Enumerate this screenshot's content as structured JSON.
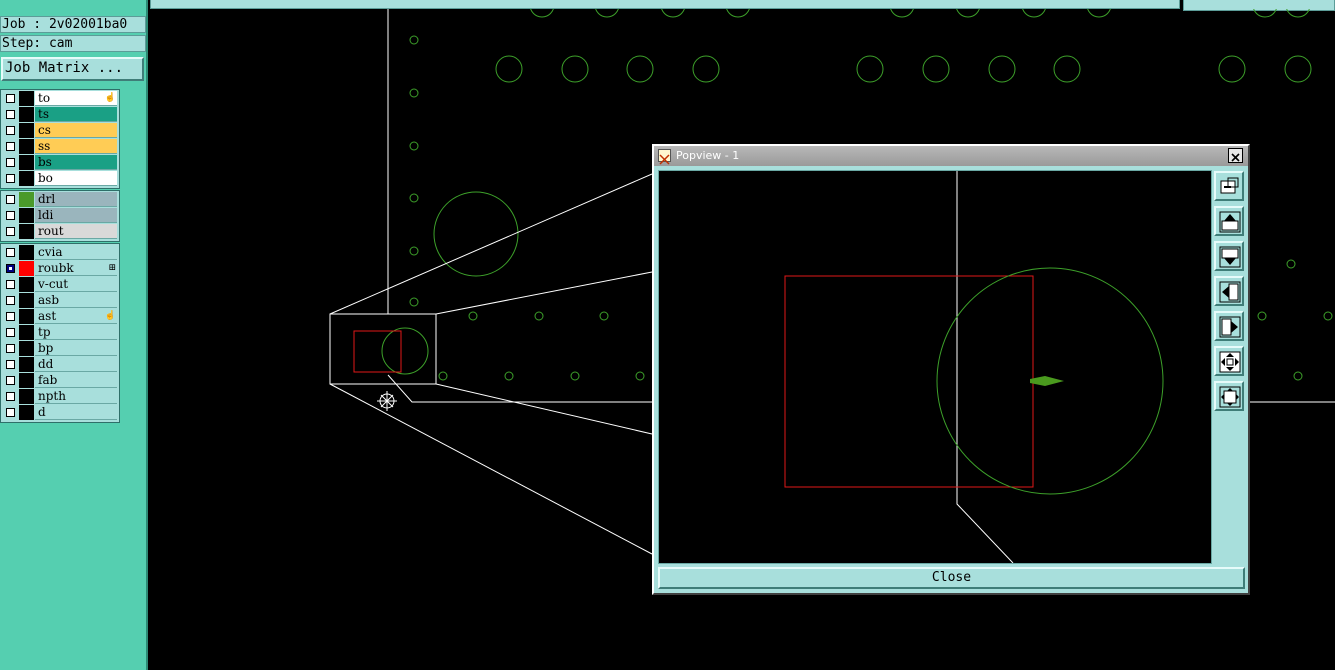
{
  "job_panel": {
    "job_text": "Job : 2v02001ba0",
    "step_text": "Step: cam",
    "job_matrix_label": "Job Matrix ..."
  },
  "layers": {
    "group1": [
      {
        "name": "to",
        "bg": "#ffffff",
        "swatch": "#000000",
        "mark": "hand-icon"
      },
      {
        "name": "ts",
        "bg": "#1aa085",
        "swatch": "#000000",
        "mark": ""
      },
      {
        "name": "cs",
        "bg": "#ffcc55",
        "swatch": "#000000",
        "mark": ""
      },
      {
        "name": "ss",
        "bg": "#ffcc55",
        "swatch": "#000000",
        "mark": ""
      },
      {
        "name": "bs",
        "bg": "#1aa085",
        "swatch": "#000000",
        "mark": ""
      },
      {
        "name": "bo",
        "bg": "#ffffff",
        "swatch": "#000000",
        "mark": ""
      }
    ],
    "group2": [
      {
        "name": "drl",
        "bg": "#9ab5bd",
        "swatch": "#4a9a2a",
        "mark": ""
      },
      {
        "name": "ldi",
        "bg": "#9ab5bd",
        "swatch": "#000000",
        "mark": ""
      },
      {
        "name": "rout",
        "bg": "#d9d9d9",
        "swatch": "#000000",
        "mark": ""
      }
    ],
    "group3": [
      {
        "name": "cvia",
        "bg": "#a8dfdc",
        "swatch": "#000000",
        "mark": ""
      },
      {
        "name": "roubk",
        "bg": "#a8dfdc",
        "swatch": "#ff0000",
        "mark": "plus-box-icon",
        "selected": true
      },
      {
        "name": "v-cut",
        "bg": "#a8dfdc",
        "swatch": "#000000",
        "mark": ""
      },
      {
        "name": "asb",
        "bg": "#a8dfdc",
        "swatch": "#000000",
        "mark": ""
      },
      {
        "name": "ast",
        "bg": "#a8dfdc",
        "swatch": "#000000",
        "mark": "hand-icon"
      },
      {
        "name": "tp",
        "bg": "#a8dfdc",
        "swatch": "#000000",
        "mark": ""
      },
      {
        "name": "bp",
        "bg": "#a8dfdc",
        "swatch": "#000000",
        "mark": ""
      },
      {
        "name": "dd",
        "bg": "#a8dfdc",
        "swatch": "#000000",
        "mark": ""
      },
      {
        "name": "fab",
        "bg": "#a8dfdc",
        "swatch": "#000000",
        "mark": ""
      },
      {
        "name": "npth",
        "bg": "#a8dfdc",
        "swatch": "#000000",
        "mark": ""
      },
      {
        "name": "d",
        "bg": "#a8dfdc",
        "swatch": "#000000",
        "mark": ""
      }
    ]
  },
  "popview": {
    "title": "Popview - 1",
    "close_label": "Close",
    "toolbar": [
      {
        "icon": "zoom-window-icon"
      },
      {
        "icon": "pan-up-icon"
      },
      {
        "icon": "pan-down-icon"
      },
      {
        "icon": "pan-left-icon"
      },
      {
        "icon": "pan-right-icon"
      },
      {
        "icon": "zoom-fit-icon"
      },
      {
        "icon": "zoom-center-icon"
      }
    ]
  },
  "colors": {
    "panel_bg": "#55cfb0",
    "widget_bg": "#a8dfdc",
    "board_outline": "#ffffff",
    "drill_green": "#3da02a",
    "rout_red": "#e01818",
    "cursor_arrow": "#4a9a1e"
  }
}
